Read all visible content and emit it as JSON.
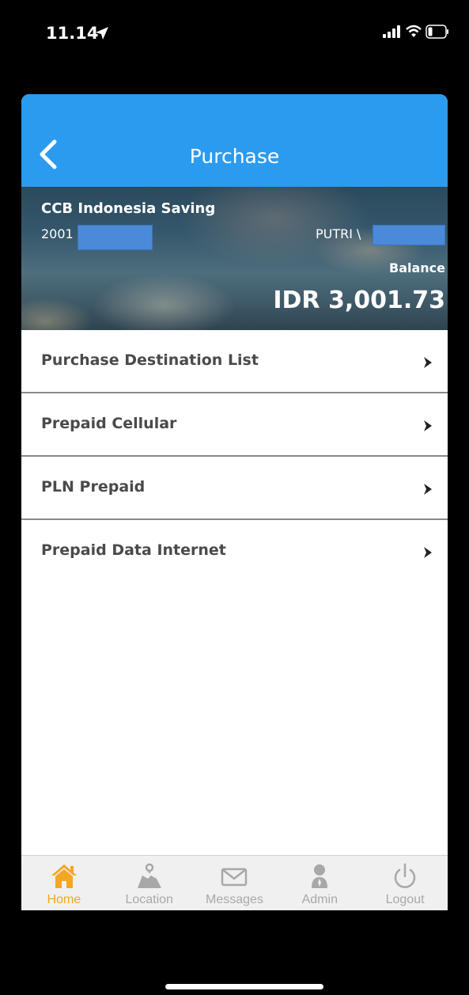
{
  "status_bar": {
    "time": "11.14"
  },
  "nav": {
    "title": "Purchase"
  },
  "account": {
    "name": "CCB Indonesia Saving",
    "number_prefix": "2001",
    "owner_prefix": "PUTRI \\",
    "balance_label": "Balance",
    "balance_amount": "IDR 3,001.73"
  },
  "menu": {
    "items": [
      {
        "label": "Purchase Destination List"
      },
      {
        "label": "Prepaid Cellular"
      },
      {
        "label": "PLN Prepaid"
      },
      {
        "label": "Prepaid Data Internet"
      }
    ]
  },
  "tabs": [
    {
      "label": "Home",
      "icon": "home-icon",
      "active": true
    },
    {
      "label": "Location",
      "icon": "map-icon",
      "active": false
    },
    {
      "label": "Messages",
      "icon": "envelope-icon",
      "active": false
    },
    {
      "label": "Admin",
      "icon": "admin-icon",
      "active": false
    },
    {
      "label": "Logout",
      "icon": "power-icon",
      "active": false
    }
  ],
  "colors": {
    "nav_blue": "#2b9bf0",
    "active_tab": "#f5a623",
    "inactive_tab": "#a8a8a8",
    "mask_blue": "#4a8ad8"
  }
}
